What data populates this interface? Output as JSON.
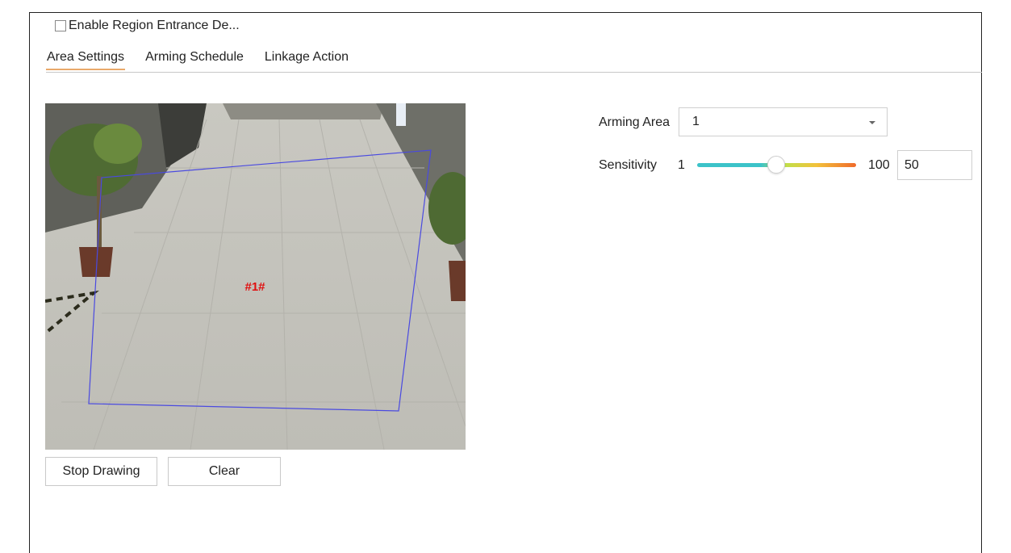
{
  "enable": {
    "label": "Enable Region Entrance De...",
    "checked": false
  },
  "tabs": [
    {
      "label": "Area Settings",
      "active": true
    },
    {
      "label": "Arming Schedule",
      "active": false
    },
    {
      "label": "Linkage Action",
      "active": false
    }
  ],
  "video": {
    "region_label": "#1#",
    "region_color": "#4a4ae0",
    "label_color": "#e01010"
  },
  "buttons": {
    "stop_drawing": "Stop Drawing",
    "clear": "Clear"
  },
  "arming_area": {
    "label": "Arming Area",
    "value": "1"
  },
  "sensitivity": {
    "label": "Sensitivity",
    "min": "1",
    "max": "100",
    "value": "50",
    "level": 50
  },
  "colors": {
    "tab_underline": "#e9a96a",
    "slider_start": "#3cc3c9",
    "slider_end": "#f06a2a"
  }
}
